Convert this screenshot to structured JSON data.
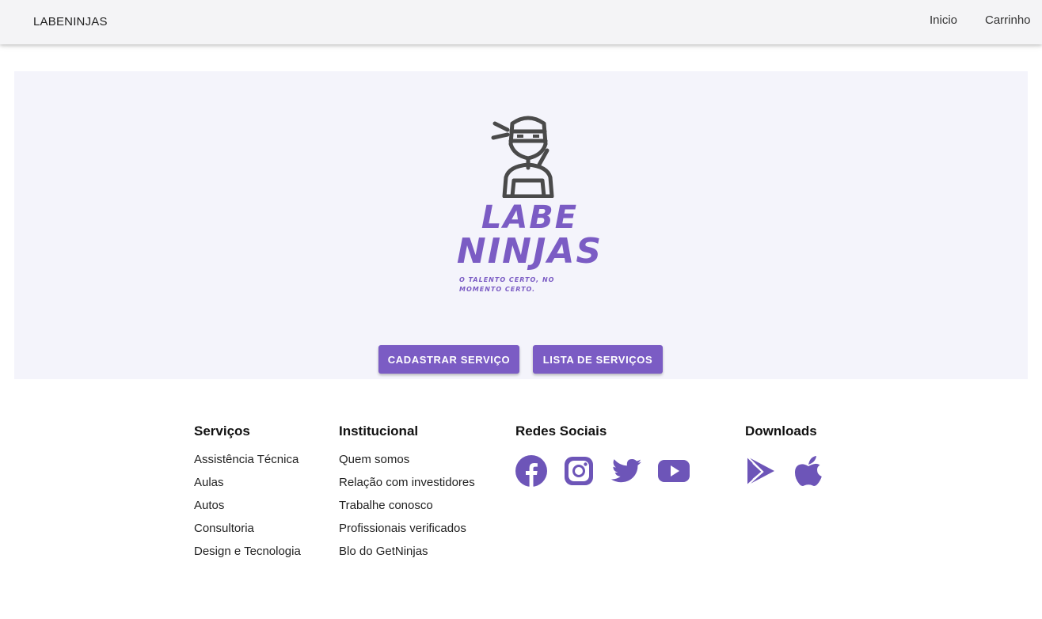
{
  "header": {
    "brand": "LABENINJAS",
    "nav": {
      "inicio": "Inicio",
      "carrinho": "Carrinho"
    }
  },
  "hero": {
    "logo": {
      "word_1": "LABE",
      "word_2": "NINJAS",
      "tagline": "O TALENTO CERTO, NO MOMENTO CERTO."
    },
    "buttons": {
      "cadastrar": "CADASTRAR SERVIÇO",
      "lista": "LISTA DE SERVIÇOS"
    }
  },
  "footer": {
    "servicos": {
      "title": "Serviços",
      "items": [
        "Assistência Técnica",
        "Aulas",
        "Autos",
        "Consultoria",
        "Design e Tecnologia"
      ]
    },
    "institucional": {
      "title": "Institucional",
      "items": [
        "Quem somos",
        "Relação com investidores",
        "Trabalhe conosco",
        "Profissionais verificados",
        "Blo do GetNinjas"
      ]
    },
    "redes": {
      "title": "Redes Sociais",
      "icons": [
        "facebook-icon",
        "instagram-icon",
        "twitter-icon",
        "youtube-icon"
      ]
    },
    "downloads": {
      "title": "Downloads",
      "icons": [
        "google-play-icon",
        "apple-icon"
      ]
    }
  },
  "colors": {
    "accent": "#7b5cc4",
    "icon_purple": "#6d55b8",
    "hero_bg": "#f4f4fb",
    "appbar_bg": "#f4f4f6",
    "logo_dark": "#4a4a4a"
  }
}
